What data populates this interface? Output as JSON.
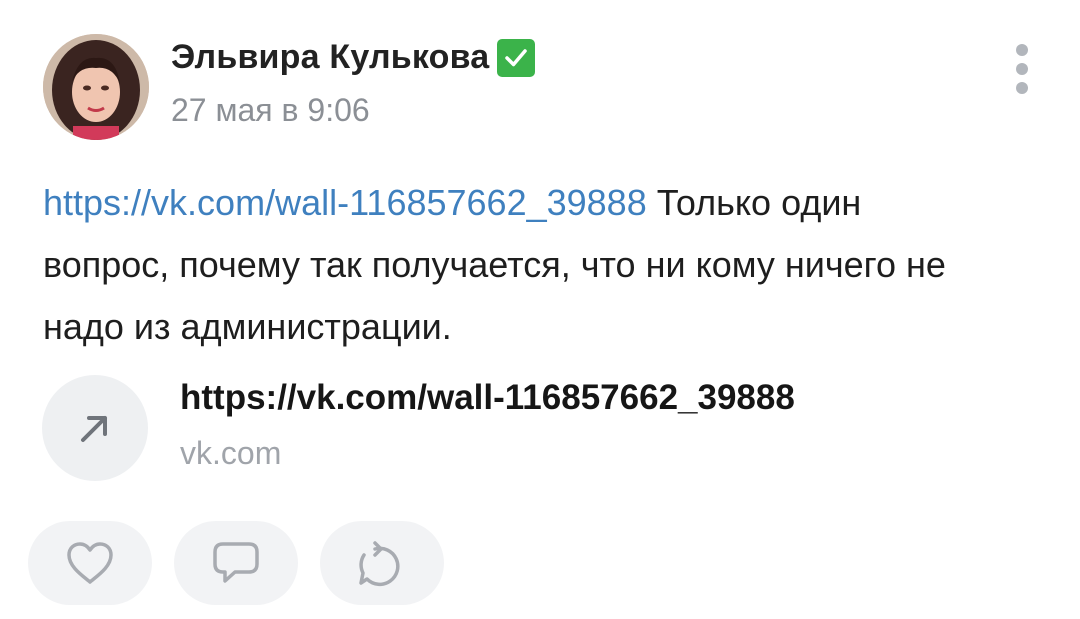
{
  "post": {
    "author_name": "Эльвира Кулькова",
    "verified_badge": "✅",
    "date": "27 мая в 9:06",
    "text_link": "https://vk.com/wall-116857662_39888",
    "text_line1_rest": " Только один",
    "text_line2": "вопрос, почему так получается, что ни кому ничего не",
    "text_line3": "надо из  администрации."
  },
  "snippet": {
    "title": "https://vk.com/wall-116857662_39888",
    "domain": "vk.com",
    "icon": "arrow-up-right-icon"
  },
  "actions": {
    "like_icon": "heart-icon",
    "comment_icon": "comment-icon",
    "share_icon": "share-icon"
  },
  "colors": {
    "link": "#3f80bf",
    "verified": "#3bb34a",
    "secondary_text": "#8b8f95",
    "icon_gray": "#a8abb1"
  }
}
